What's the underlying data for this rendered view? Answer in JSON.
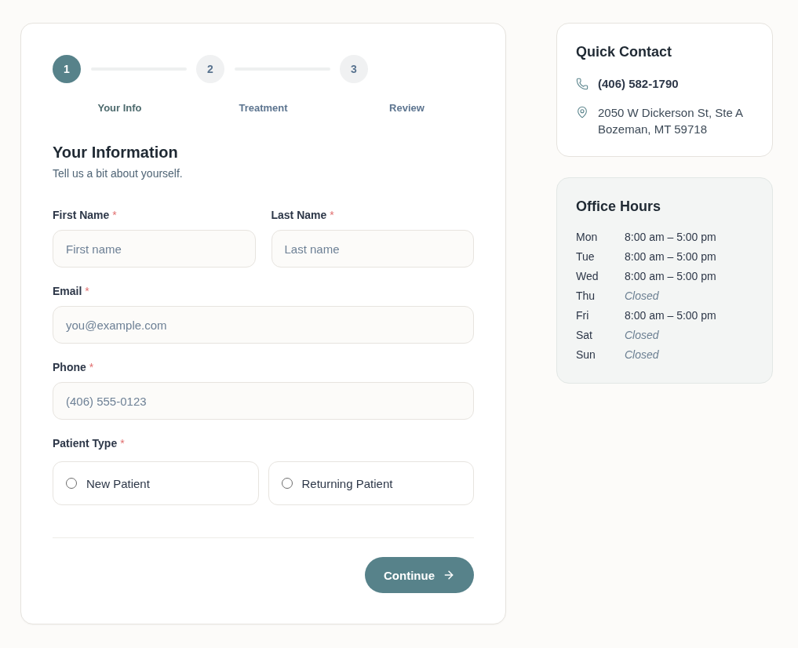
{
  "stepper": {
    "steps": [
      {
        "number": "1",
        "label": "Your Info",
        "selected": true
      },
      {
        "number": "2",
        "label": "Treatment",
        "selected": false
      },
      {
        "number": "3",
        "label": "Review",
        "selected": false
      }
    ]
  },
  "form": {
    "title": "Your Information",
    "subtitle": "Tell us a bit about yourself.",
    "name_fields": [
      {
        "label": "First Name",
        "required_mark": "*",
        "placeholder": "First name"
      },
      {
        "label": "Last Name",
        "required_mark": "*",
        "placeholder": "Last name"
      }
    ],
    "fields": [
      {
        "label": "Email",
        "required_mark": "*",
        "placeholder": "you@example.com"
      },
      {
        "label": "Phone",
        "required_mark": "*",
        "placeholder": "(406) 555-0123"
      }
    ],
    "patient_type": {
      "label": "Patient Type",
      "required_mark": "*",
      "options": [
        {
          "label": "New Patient",
          "selected": false
        },
        {
          "label": "Returning Patient",
          "selected": false
        }
      ]
    },
    "continue_button": {
      "label": "Continue"
    }
  },
  "quick_contact": {
    "title": "Quick Contact",
    "phone": "(406) 582-1790",
    "address_lines": [
      "2050 W Dickerson St, Ste A",
      "Bozeman, MT 59718"
    ]
  },
  "office_hours": {
    "title": "Office Hours",
    "rows": [
      {
        "day": "Mon",
        "hours": "8:00 am – 5:00 pm",
        "closed": false
      },
      {
        "day": "Tue",
        "hours": "8:00 am – 5:00 pm",
        "closed": false
      },
      {
        "day": "Wed",
        "hours": "8:00 am – 5:00 pm",
        "closed": false
      },
      {
        "day": "Thu",
        "hours": "Closed",
        "closed": true
      },
      {
        "day": "Fri",
        "hours": "8:00 am – 5:00 pm",
        "closed": false
      },
      {
        "day": "Sat",
        "hours": "Closed",
        "closed": true
      },
      {
        "day": "Sun",
        "hours": "Closed",
        "closed": true
      }
    ]
  }
}
